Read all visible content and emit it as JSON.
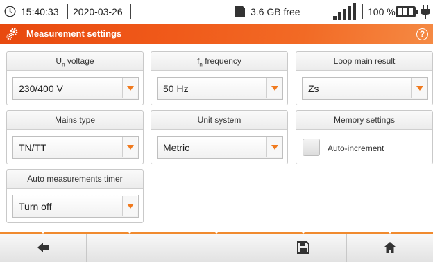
{
  "status": {
    "time": "15:40:33",
    "date": "2020-03-26",
    "storage_free": "3.6 GB free",
    "battery": "100 %",
    "icons": [
      "clock-icon",
      "sd-card-icon",
      "signal-bars-icon",
      "battery-icon",
      "power-plug-icon"
    ]
  },
  "header": {
    "title": "Measurement settings",
    "help": "?"
  },
  "settings": {
    "un_voltage": {
      "label_main": "U",
      "label_sub": "n",
      "label_rest": " voltage",
      "value": "230/400 V"
    },
    "fn_frequency": {
      "label_main": "f",
      "label_sub": "n",
      "label_rest": " frequency",
      "value": "50 Hz"
    },
    "loop_result": {
      "label": "Loop main result",
      "value": "Zs"
    },
    "mains_type": {
      "label": "Mains type",
      "value": "TN/TT"
    },
    "unit_system": {
      "label": "Unit system",
      "value": "Metric"
    },
    "memory": {
      "label": "Memory settings",
      "checkbox_label": "Auto-increment",
      "checked": false
    },
    "auto_timer": {
      "label": "Auto measurements timer",
      "value": "Turn off"
    }
  },
  "colors": {
    "accent": "#f05a1a",
    "dropdown_arrow": "#f07a1e",
    "bottom_line": "#f08a2e"
  },
  "bottom_bar": {
    "buttons": [
      "back-arrow-icon",
      "",
      "",
      "save-floppy-icon",
      "home-icon"
    ]
  }
}
